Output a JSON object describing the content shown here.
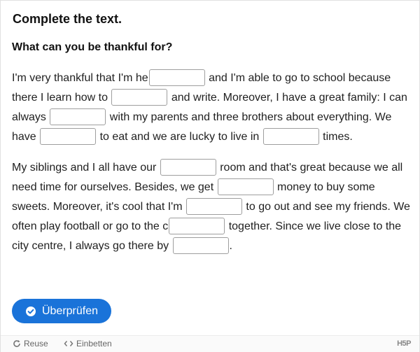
{
  "title": "Complete the text.",
  "question": "What can you be thankful for?",
  "paragraphs": [
    {
      "segments": [
        "I'm very thankful that I'm he",
        " and I'm able to go to school because there I learn how to ",
        " and write. Moreover, I have a great family: I can always ",
        " with my parents and three brothers about everything. We have ",
        " to eat and we are lucky to live in ",
        " times."
      ]
    },
    {
      "segments": [
        "My siblings and I all have our ",
        " room and that's great because we all need time for ourselves. Besides, we get ",
        " money to buy some sweets. Moreover, it's cool that I'm ",
        " to go out and see my friends. We often play football or go to the c",
        " together. Since we live close to the city centre, I always go there by ",
        "."
      ]
    }
  ],
  "blanks": [
    "",
    "",
    "",
    "",
    "",
    "",
    "",
    "",
    "",
    ""
  ],
  "check_button": {
    "label": "Überprüfen",
    "icon": "check-circle-icon"
  },
  "footer": {
    "reuse_label": "Reuse",
    "embed_label": "Einbetten",
    "logo_text": "H5P"
  },
  "colors": {
    "accent": "#1a73d9",
    "input_border": "#9e9e9e",
    "footer_bg": "#fafafa"
  }
}
